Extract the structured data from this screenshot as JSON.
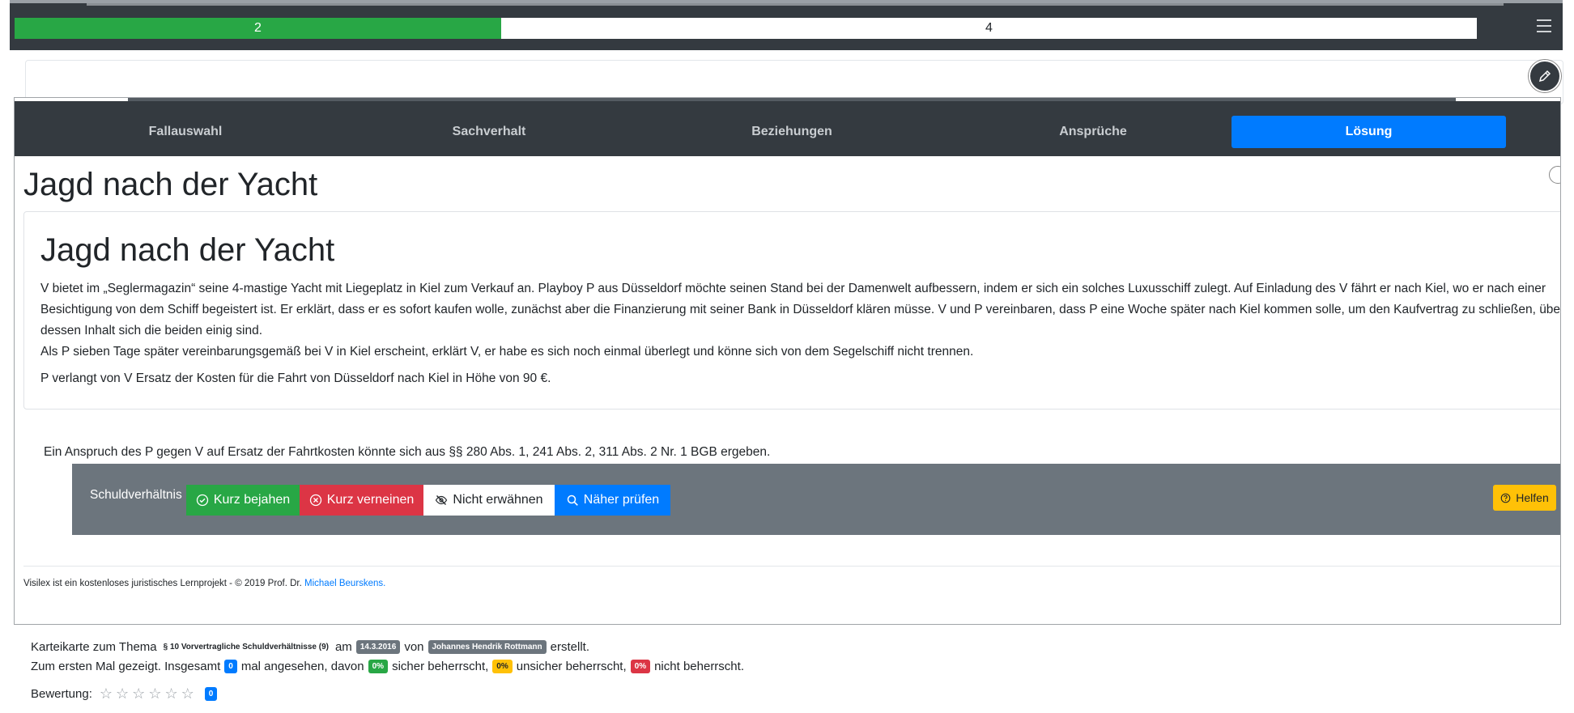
{
  "progress": {
    "done_label": "2",
    "remaining_label": "4",
    "done_fraction": 0.333,
    "done_color": "#28a745"
  },
  "nav": {
    "tabs": [
      {
        "label": "Fallauswahl",
        "active": false
      },
      {
        "label": "Sachverhalt",
        "active": false
      },
      {
        "label": "Beziehungen",
        "active": false
      },
      {
        "label": "Ansprüche",
        "active": false
      },
      {
        "label": "Lösung",
        "active": true
      }
    ],
    "active_color": "#007bff"
  },
  "case": {
    "page_title": "Jagd nach der Yacht",
    "story_title": "Jagd nach der Yacht",
    "paragraphs": [
      "V bietet im „Seglermagazin“ seine 4-mastige Yacht mit Liegeplatz in Kiel zum Verkauf an. Playboy P aus Düsseldorf möchte seinen Stand bei der Damenwelt aufbessern, indem er sich ein solches Luxusschiff zulegt. Auf Einladung des V fährt er nach Kiel, wo er nach einer Besichtigung von dem Schiff begeistert ist. Er erklärt, dass er es sofort kaufen wolle, zunächst aber die Finanzierung mit seiner Bank in Düsseldorf klären müsse. V und P vereinbaren, dass P eine Woche später nach Kiel kommen solle, um den Kaufvertrag zu schließen, über dessen Inhalt sich die beiden einig sind.",
      "Als P sieben Tage später vereinbarungsgemäß bei V in Kiel erscheint, erklärt V, er habe es sich noch einmal überlegt und könne sich von dem Segelschiff nicht trennen.",
      "P verlangt von V Ersatz der Kosten für die Fahrt von Düsseldorf nach Kiel in Höhe von 90 €."
    ]
  },
  "solution": {
    "claim_text": "Ein Anspruch des P gegen V auf Ersatz der Fahrtkosten könnte sich aus §§ 280 Abs. 1, 241 Abs. 2, 311 Abs. 2 Nr. 1 BGB ergeben.",
    "step_label": "Schuldverhältnis",
    "buttons": {
      "affirm": "Kurz bejahen",
      "deny": "Kurz verneinen",
      "omit": "Nicht erwähnen",
      "examine": "Näher prüfen",
      "help": "Helfen"
    }
  },
  "footer": {
    "text": "Visilex ist ein kostenloses juristisches Lernprojekt - © 2019 Prof. Dr. ",
    "author_link": "Michael Beurskens."
  },
  "meta": {
    "line1_prefix": "Karteikarte zum Thema",
    "topic": "§ 10 Vorvertragliche Schuldverhältnisse (9)",
    "on_label": "am",
    "date": "14.3.2016",
    "by_label": "von",
    "author": "Johannes Hendrik Rottmann",
    "created_label": "erstellt.",
    "line2_prefix": "Zum ersten Mal gezeigt. Insgesamt",
    "views": "0",
    "views_suffix": "mal angesehen, davon",
    "sure_pct": "0%",
    "sure_label": "sicher beherrscht,",
    "unsure_pct": "0%",
    "unsure_label": "unsicher beherrscht,",
    "not_pct": "0%",
    "not_label": "nicht beherrscht.",
    "rating_label": "Bewertung:",
    "rating_count": "0",
    "rating_stars": 0,
    "max_stars": 6
  }
}
